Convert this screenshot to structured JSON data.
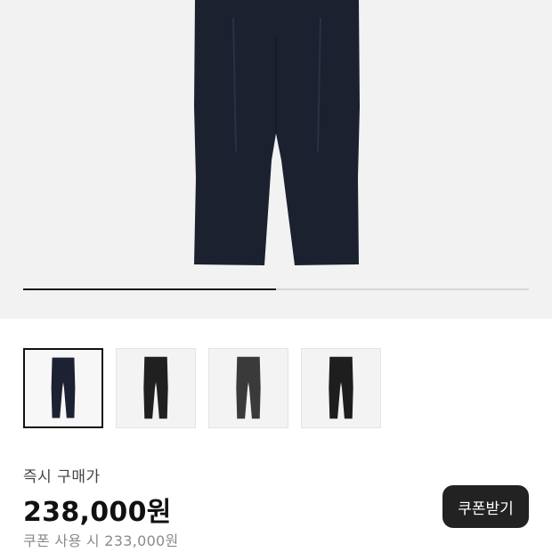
{
  "product": {
    "main_image": "navy-wide-pants-image",
    "image_progress": 0.5,
    "thumbnails": [
      {
        "name": "navy-pants-thumbnail",
        "color": "#1c2133",
        "selected": true
      },
      {
        "name": "black-pants-thumbnail",
        "color": "#202020",
        "selected": false
      },
      {
        "name": "charcoal-pants-thumbnail",
        "color": "#3a3a3a",
        "selected": false
      },
      {
        "name": "black-pants-thumbnail-2",
        "color": "#1e1e1e",
        "selected": false
      }
    ]
  },
  "purchase": {
    "label": "즉시 구매가",
    "price": "238,000원",
    "coupon_price": "쿠폰 사용 시 233,000원",
    "coupon_button": "쿠폰받기"
  },
  "colors": {
    "hero_background": "#f2f2f2",
    "accent": "#222222"
  }
}
